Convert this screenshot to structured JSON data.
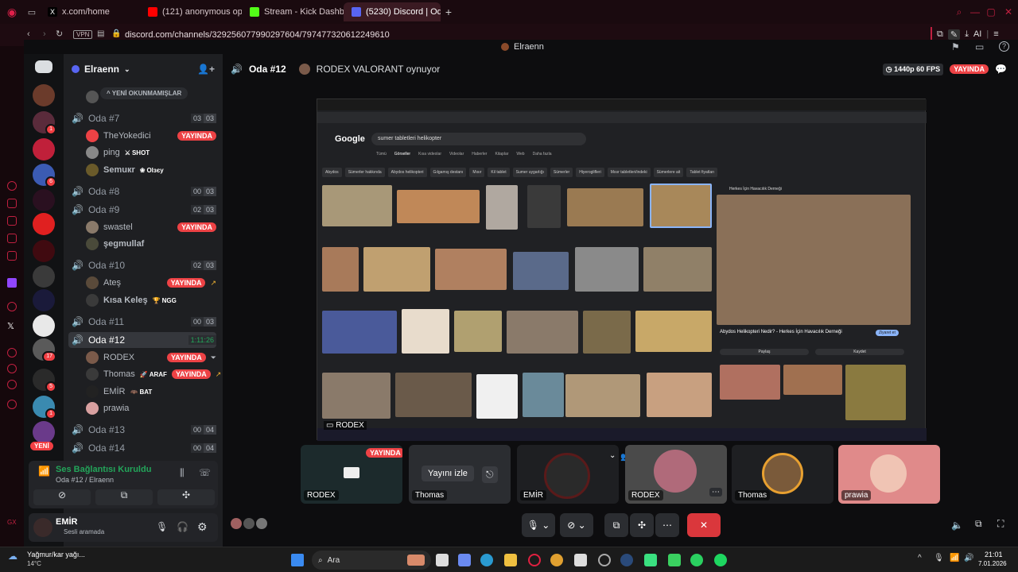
{
  "browser": {
    "tabs": [
      {
        "label": "x.com/home"
      },
      {
        "label": "(121) anonymous opturkey"
      },
      {
        "label": "Stream - Kick Dashboard"
      },
      {
        "label": "(5230) Discord | Oda #12"
      }
    ],
    "url": "discord.com/channels/329256077990297604/797477320612249610",
    "vpn_label": "VPN",
    "profile_name": "Elraenn",
    "ai_label": "AI"
  },
  "discord": {
    "server_name": "Elraenn",
    "unread_label": "YENİ OKUNMAMIŞLAR",
    "channels": [
      {
        "name": "Oda #7",
        "a": "03",
        "b": "03"
      },
      {
        "name": "Oda #8",
        "a": "00",
        "b": "03"
      },
      {
        "name": "Oda #9",
        "a": "02",
        "b": "03"
      },
      {
        "name": "Oda #10",
        "a": "02",
        "b": "03"
      },
      {
        "name": "Oda #11",
        "a": "00",
        "b": "03"
      },
      {
        "name": "Oda #12",
        "timer": "1:11:26"
      },
      {
        "name": "Oda #13",
        "a": "00",
        "b": "04"
      },
      {
        "name": "Oda #14",
        "a": "00",
        "b": "04"
      }
    ],
    "users": {
      "oda7": [
        {
          "name": "TheYokedici",
          "live": "YAYINDA"
        },
        {
          "name": "ping",
          "tag": "SHOT"
        },
        {
          "name": "Semuкr",
          "tag": "Olзєу"
        }
      ],
      "oda9": [
        {
          "name": "swastel",
          "live": "YAYINDA"
        },
        {
          "name": "şegmullaf"
        }
      ],
      "oda10": [
        {
          "name": "Ateş",
          "live": "YAYINDA"
        },
        {
          "name": "Kısa Keleş",
          "tag": "NGG"
        }
      ],
      "oda12": [
        {
          "name": "RODEX",
          "live": "YAYINDA"
        },
        {
          "name": "Thomas",
          "tag": "ARAF",
          "live": "YAYINDA"
        },
        {
          "name": "EMİR",
          "tag": "BAT"
        },
        {
          "name": "prawia"
        }
      ]
    },
    "new_badge": "YENİ",
    "voice_status": "Ses Bağlantısı Kuruldu",
    "voice_channel": "Oda #12 / Elraenn",
    "user_name": "EMİR",
    "user_status": "Sesli aramada",
    "server_badges": [
      "1",
      "6",
      "5",
      "17",
      "5",
      "1"
    ],
    "left_label": "GX"
  },
  "stream": {
    "channel": "Oda #12",
    "activity": "RODEX VALORANT oynuyor",
    "quality": "1440p 60 FPS",
    "live": "YAYINDA",
    "streamer_label": "RODEX",
    "watch_button": "Yayını izle",
    "participants": [
      {
        "name": "RODEX"
      },
      {
        "name": "Thomas"
      },
      {
        "name": "EMİR"
      },
      {
        "name": "RODEX"
      },
      {
        "name": "Thomas"
      },
      {
        "name": "prawia"
      }
    ],
    "participant_live": "YAYINDA"
  },
  "shared_screen": {
    "search_query": "sumer tabletleri helikopter",
    "filters": [
      "Tümü",
      "Görseller",
      "Kısa videolar",
      "Videolar",
      "Haberler",
      "Kitaplar",
      "Web",
      "Daha fazla"
    ],
    "chips": [
      "Abydos",
      "Sümerler hakkında",
      "Abydos helikopteri",
      "Gılgamış destanı",
      "Mısır",
      "Kil tablet",
      "Sumer uygarlığı",
      "Sümerler",
      "Hiyeroglifleri",
      "Mısır tabletleri/indeki",
      "Sümerlere ait",
      "Tablet fiyatları"
    ],
    "panel_site": "Herkes İçin Havacılık Derneği",
    "panel_title": "Abydos Helikopteri Nedir? - Herkes İçin Havacılık Derneği",
    "visit_button": "Ziyaret et",
    "share_button": "Paylaş",
    "save_button": "Kaydet"
  },
  "taskbar": {
    "weather": "Yağmur/kar yağı...",
    "temp": "14°C",
    "search": "Ara",
    "time": "21:01",
    "date": "7.01.2026"
  },
  "colors": {
    "accent_live": "#ed4245",
    "discord_green": "#23a55a",
    "browser_accent": "#c02040"
  }
}
